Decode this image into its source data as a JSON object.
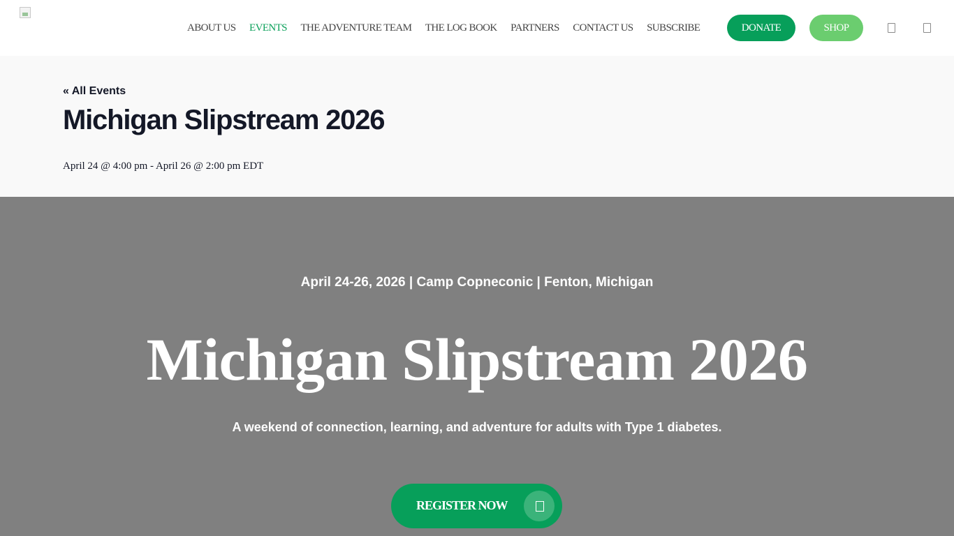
{
  "header": {
    "nav": [
      {
        "label": "ABOUT US",
        "active": false
      },
      {
        "label": "EVENTS",
        "active": true
      },
      {
        "label": "THE ADVENTURE TEAM",
        "active": false
      },
      {
        "label": "THE LOG BOOK",
        "active": false
      },
      {
        "label": "PARTNERS",
        "active": false
      },
      {
        "label": "CONTACT US",
        "active": false
      },
      {
        "label": "SUBSCRIBE",
        "active": false
      }
    ],
    "donate_label": "DONATE",
    "shop_label": "SHOP",
    "icons": [
      "search-icon",
      "cart-icon"
    ]
  },
  "event": {
    "back_link": "« All Events",
    "title": "Michigan Slipstream 2026",
    "dates": "April 24 @ 4:00 pm - April 26 @ 2:00 pm EDT"
  },
  "hero": {
    "subtitle": "April 24-26, 2026 | Camp Copneconic | Fenton, Michigan",
    "title": "Michigan Slipstream 2026",
    "description": "A weekend of connection, learning, and adventure for adults with Type 1 diabetes.",
    "cta_label": "REGISTER NOW",
    "cta_icon": "arrow-icon"
  },
  "colors": {
    "accent": "#079f5a",
    "shop": "#6bcd6f",
    "hero_bg": "#808080",
    "title_band_bg": "#f9f9f9",
    "heading_text": "#141827"
  }
}
